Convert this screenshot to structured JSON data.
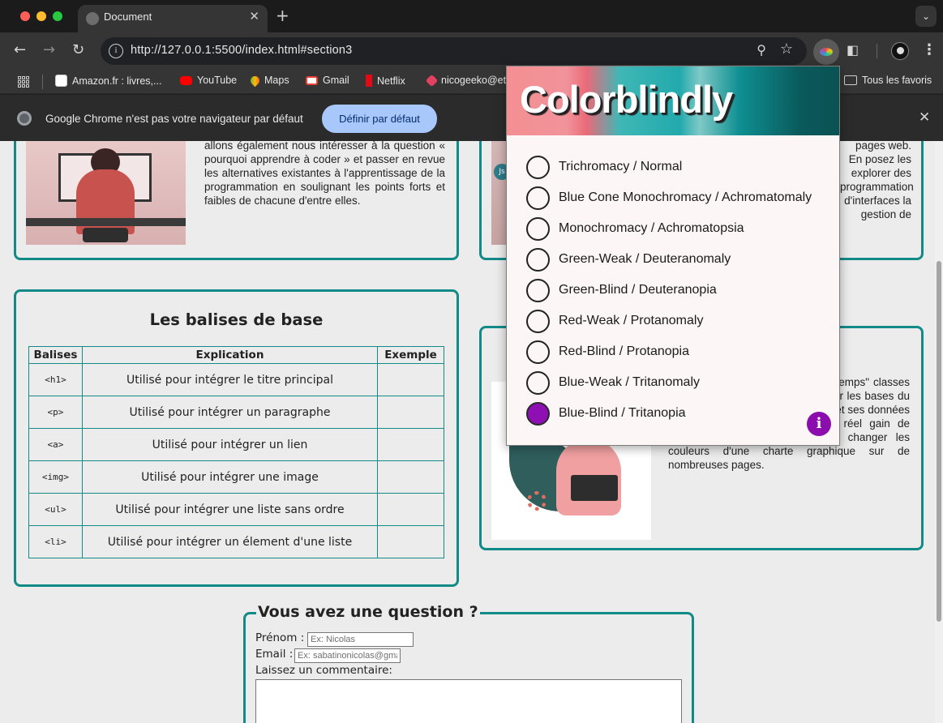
{
  "browser": {
    "tab_title": "Document",
    "tab_close": "✕",
    "new_tab": "+",
    "tabs_menu": "⌄",
    "url": "http://127.0.0.1:5500/index.html#section3",
    "bookmarks": [
      {
        "label": "Amazon.fr : livres,..."
      },
      {
        "label": "YouTube"
      },
      {
        "label": "Maps"
      },
      {
        "label": "Gmail"
      },
      {
        "label": "Netflix"
      },
      {
        "label": "nicogeeko@et"
      }
    ],
    "all_favorites": "Tous les favoris",
    "infobar_text": "Google Chrome n'est pas votre navigateur par défaut",
    "infobar_button": "Définir par défaut",
    "infobar_close": "✕"
  },
  "page": {
    "top_left_text": "l'ensemble des langages informatiques. Nous allons également nous intéresser à la question « pourquoi apprendre à coder » et passer en revue les alternatives existantes à l'apprentissage de la programmation en soulignant les points forts et faibles de chacune d'entre elles.",
    "top_right_text": "permettant de pages web. En posez les explorer des programmation d'interfaces la gestion de",
    "top_right_badge": "Js",
    "balises": {
      "title": "Les balises de base",
      "headers": [
        "Balises",
        "Explication",
        "Exemple"
      ],
      "rows": [
        {
          "tag": "<h1>",
          "desc": "Utilisé pour intégrer le titre principal",
          "example": ""
        },
        {
          "tag": "<p>",
          "desc": "Utilisé pour intégrer un paragraphe",
          "example": ""
        },
        {
          "tag": "<a>",
          "desc": "Utilisé pour intégrer un lien",
          "example": ""
        },
        {
          "tag": "<img>",
          "desc": "Utilisé pour intégrer une image",
          "example": ""
        },
        {
          "tag": "<ul>",
          "desc": "Utilisé pour intégrer une liste sans ordre",
          "example": ""
        },
        {
          "tag": "<li>",
          "desc": "Utilisé pour intégrer un élement d'une liste",
          "example": ""
        }
      ]
    },
    "css_text": "et CSS il est temps avant ...e du temps\" classes des ...r par la suite. Penser à poser les bases du fichier css avec la notion de \"root\" et ses données constituées de variables est un réel gain de temps si l'on doit par exemple changer les couleurs d'une charte graphique sur de nombreuses pages.",
    "form": {
      "legend": "Vous avez une question ?",
      "prenom_label": "Prénom :",
      "prenom_placeholder": "Ex: Nicolas",
      "email_label": "Email :",
      "email_placeholder": "Ex: sabatinonicolas@gmail.com",
      "comment_label": "Laissez un commentaire:"
    }
  },
  "colorblindly": {
    "title": "Colorblindly",
    "options": [
      {
        "label": "Trichromacy / Normal",
        "checked": false
      },
      {
        "label": "Blue Cone Monochromacy / Achromatomaly",
        "checked": false
      },
      {
        "label": "Monochromacy / Achromatopsia",
        "checked": false
      },
      {
        "label": "Green-Weak / Deuteranomaly",
        "checked": false
      },
      {
        "label": "Green-Blind / Deuteranopia",
        "checked": false
      },
      {
        "label": "Red-Weak / Protanomaly",
        "checked": false
      },
      {
        "label": "Red-Blind / Protanopia",
        "checked": false
      },
      {
        "label": "Blue-Weak / Tritanomaly",
        "checked": false
      },
      {
        "label": "Blue-Blind / Tritanopia",
        "checked": true
      }
    ],
    "info_label": "i",
    "accent_color": "#8b0dad"
  },
  "colors": {
    "card_border": "#128b88",
    "page_bg": "#ececec"
  },
  "icons": {
    "back": "arrow-left-icon",
    "forward": "arrow-right-icon",
    "reload": "reload-icon",
    "zoom": "zoom-icon",
    "star": "star-icon",
    "extension": "colorblindly-eye-icon",
    "puzzle": "puzzle-icon",
    "profile": "profile-avatar-icon",
    "menu": "kebab-menu-icon"
  }
}
